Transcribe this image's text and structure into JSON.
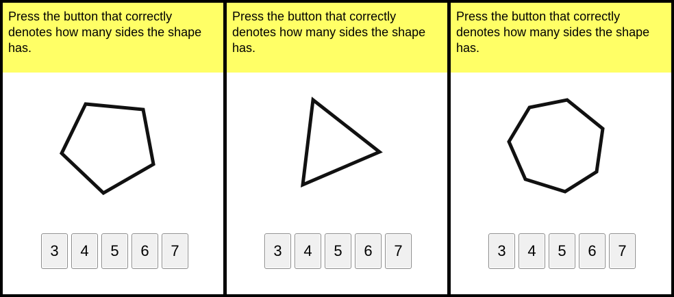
{
  "panels": [
    {
      "prompt": "Press the button that correctly denotes how many sides the shape has.",
      "shape": "pentagon",
      "options": [
        "3",
        "4",
        "5",
        "6",
        "7"
      ]
    },
    {
      "prompt": "Press the button that correctly denotes how many sides the shape has.",
      "shape": "triangle",
      "options": [
        "3",
        "4",
        "5",
        "6",
        "7"
      ]
    },
    {
      "prompt": "Press the button that correctly denotes how many sides the shape has.",
      "shape": "heptagon",
      "options": [
        "3",
        "4",
        "5",
        "6",
        "7"
      ]
    }
  ],
  "colors": {
    "prompt_background": "#ffff66",
    "panel_background": "#ffffff",
    "frame": "#000000",
    "shape_stroke": "#111111",
    "button_background": "#f0f0f0",
    "button_border": "#8a8a8a"
  }
}
